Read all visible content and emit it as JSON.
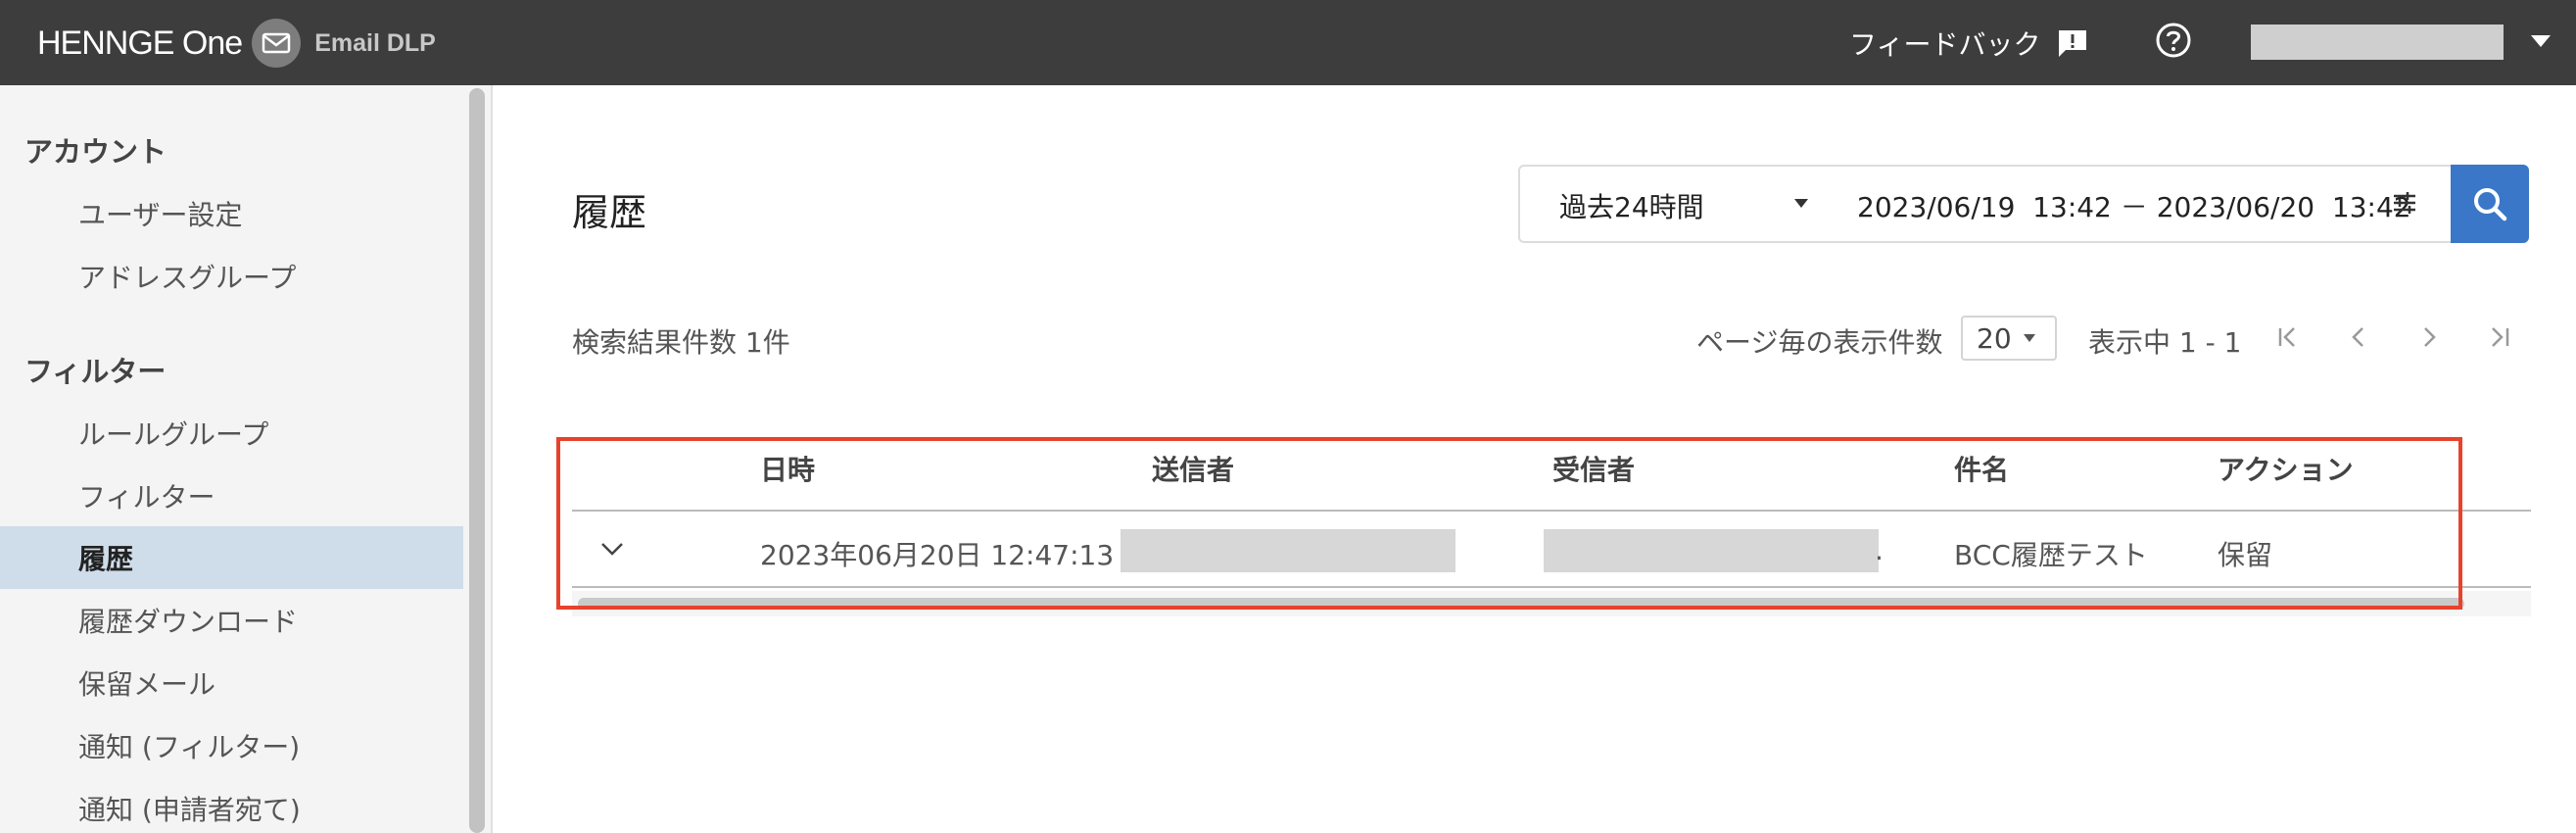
{
  "header": {
    "brand": "HENNGE One",
    "product": "Email DLP",
    "feedback_label": "フィードバック",
    "accent_color": "#3a77c9",
    "bar_color": "#3d3d3d"
  },
  "sidebar": {
    "sections": [
      {
        "heading": "アカウント",
        "items": [
          {
            "label": "ユーザー設定"
          },
          {
            "label": "アドレスグループ"
          }
        ]
      },
      {
        "heading": "フィルター",
        "items": [
          {
            "label": "ルールグループ"
          },
          {
            "label": "フィルター"
          },
          {
            "label": "履歴",
            "active": true
          },
          {
            "label": "履歴ダウンロード"
          },
          {
            "label": "保留メール"
          },
          {
            "label": "通知 (フィルター)"
          },
          {
            "label": "通知 (申請者宛て)"
          }
        ]
      }
    ],
    "active_bg": "#cfdcea"
  },
  "main": {
    "title": "履歴",
    "range": {
      "preset": "過去24時間",
      "from": "2023/06/19  13:42",
      "separator": "－",
      "to": "2023/06/20  13:42"
    },
    "result_count": "検索結果件数 1件",
    "per_page_label": "ページ毎の表示件数",
    "per_page_value": "20",
    "showing": "表示中 1 - 1",
    "table": {
      "columns": [
        "日時",
        "送信者",
        "受信者",
        "件名",
        "アクション"
      ],
      "rows": [
        {
          "datetime": "2023年06月20日 12:47:13",
          "recipient_suffix": ".",
          "subject": "BCC履歴テスト",
          "action": "保留"
        }
      ]
    },
    "highlight_color": "#e8422c"
  }
}
